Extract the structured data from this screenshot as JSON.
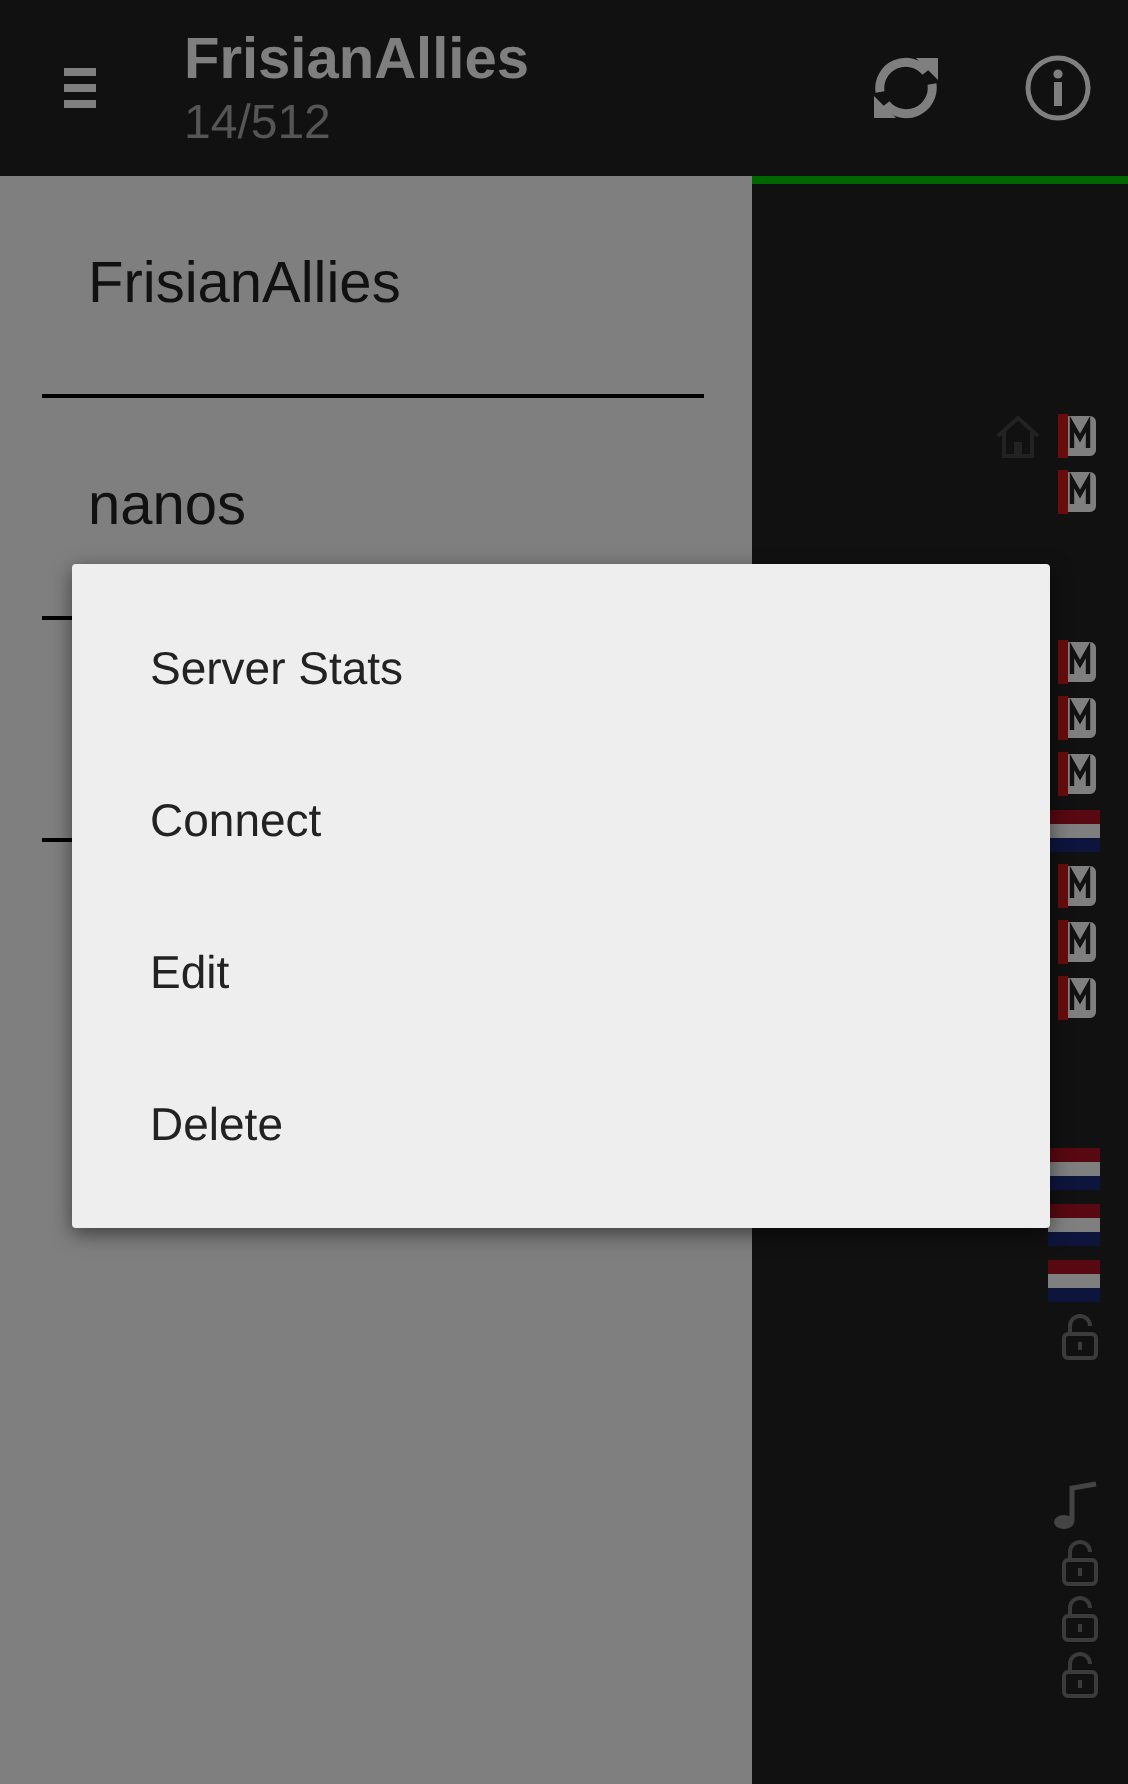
{
  "app_bar": {
    "title": "FrisianAllies",
    "subtitle": "14/512"
  },
  "drawer": {
    "items": [
      {
        "label": "FrisianAllies"
      },
      {
        "label": "nanos"
      }
    ]
  },
  "server_list": {
    "groups": [
      {
        "rows": [
          {
            "icons": [
              {
                "kind": "home"
              },
              {
                "kind": "m"
              }
            ]
          },
          {
            "icons": [
              {
                "kind": "m"
              }
            ]
          }
        ]
      },
      {
        "rows": [
          {
            "icons": [
              {
                "kind": "m"
              }
            ]
          },
          {
            "icons": [
              {
                "kind": "m"
              }
            ]
          },
          {
            "icons": [
              {
                "kind": "m"
              }
            ]
          },
          {
            "icons": [
              {
                "kind": "flag"
              }
            ]
          },
          {
            "icons": [
              {
                "kind": "m"
              }
            ]
          },
          {
            "icons": [
              {
                "kind": "m"
              }
            ]
          },
          {
            "icons": [
              {
                "kind": "m"
              }
            ]
          }
        ]
      },
      {
        "rows": [
          {
            "icons": [
              {
                "kind": "flag"
              }
            ]
          },
          {
            "icons": [
              {
                "kind": "flag"
              }
            ]
          },
          {
            "icons": [
              {
                "kind": "flag"
              }
            ]
          },
          {
            "icons": [
              {
                "kind": "lock"
              }
            ]
          }
        ]
      },
      {
        "rows": [
          {
            "icons": [
              {
                "kind": "note"
              }
            ]
          },
          {
            "icons": [
              {
                "kind": "lock"
              }
            ]
          },
          {
            "icons": [
              {
                "kind": "lock"
              }
            ]
          },
          {
            "icons": [
              {
                "kind": "lock"
              }
            ]
          }
        ]
      }
    ]
  },
  "context_menu": {
    "items": [
      "Server Stats",
      "Connect",
      "Edit",
      "Delete"
    ]
  }
}
